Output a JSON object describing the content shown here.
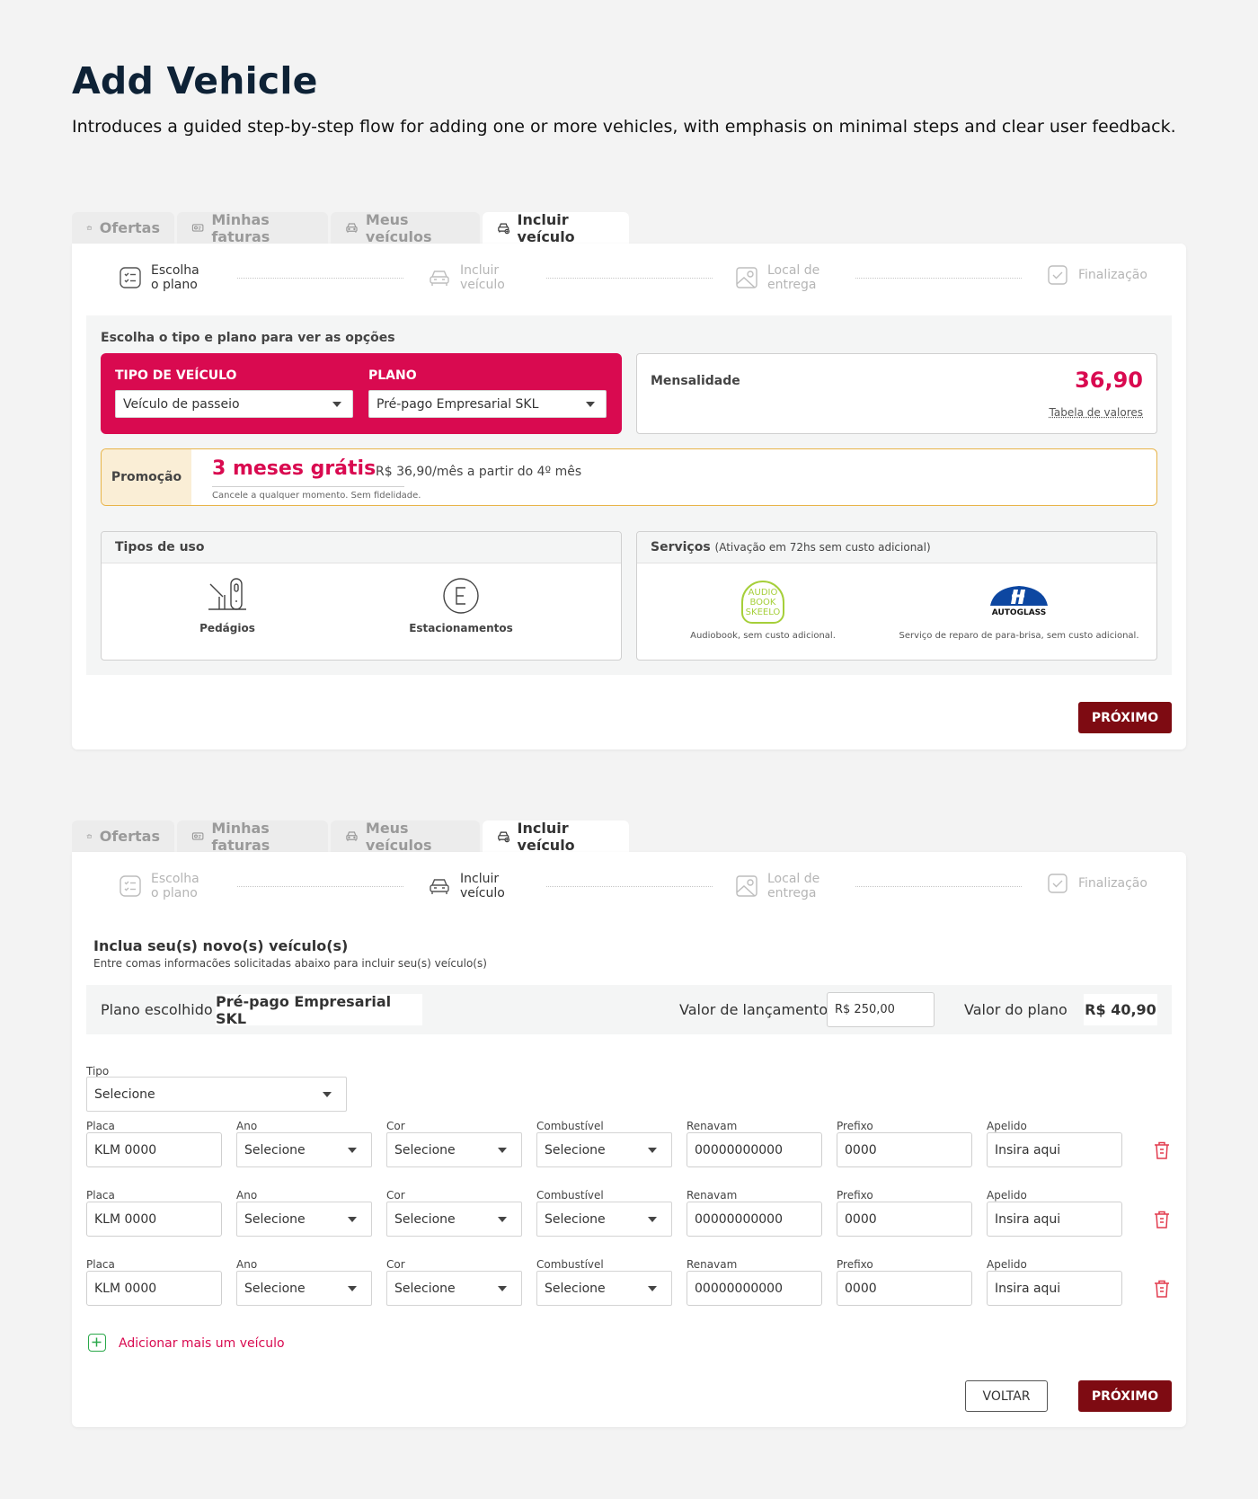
{
  "page": {
    "title": "Add Vehicle",
    "description": "Introduces a guided step-by-step flow for adding one or more vehicles, with emphasis on minimal steps and clear user feedback."
  },
  "tabs": [
    {
      "label": "Ofertas",
      "icon": "basket-icon"
    },
    {
      "label": "Minhas faturas",
      "icon": "invoice-icon"
    },
    {
      "label": "Meus veículos",
      "icon": "car-icon"
    },
    {
      "label": "Incluir veículo",
      "icon": "car-add-icon"
    }
  ],
  "steps": [
    {
      "line1": "Escolha",
      "line2": "o plano",
      "icon": "checklist-icon"
    },
    {
      "line1": "Incluir",
      "line2": "veículo",
      "icon": "car-icon"
    },
    {
      "line1": "Local de",
      "line2": "entrega",
      "icon": "map-icon"
    },
    {
      "line1": "Finalização",
      "line2": "",
      "icon": "check-icon"
    }
  ],
  "screen1": {
    "section_title": "Escolha o tipo e plano para ver as opções",
    "vehicle_type_label": "TIPO DE VEÍCULO",
    "vehicle_type_value": "Veículo de passeio",
    "plan_label": "PLANO",
    "plan_value": "Pré-pago Empresarial SKL",
    "monthly_label": "Mensalidade",
    "monthly_value": "36,90",
    "price_table_link": "Tabela de valores",
    "promo_tag": "Promoção",
    "promo_title": "3 meses grátis",
    "promo_price": "R$ 36,90/mês a partir do 4º mês",
    "promo_note": "Cancele a qualquer momento. Sem fidelidade.",
    "usage_title": "Tipos de uso",
    "usage_items": [
      "Pedágios",
      "Estacionamentos"
    ],
    "services_title": "Serviços",
    "services_note": "(Ativação em 72hs sem custo adicional)",
    "services": [
      {
        "logo_lines": [
          "AUDIO",
          "BOOK",
          "SKEELO"
        ],
        "desc": "Audiobook, sem custo adicional."
      },
      {
        "logo_text": "AUTOGLASS",
        "desc": "Serviço de reparo de para-brisa, sem custo adicional."
      }
    ],
    "next_button": "PRÓXIMO"
  },
  "screen2": {
    "section_title": "Inclua seu(s) novo(s) veículo(s)",
    "section_subtitle": "Entre comas informacões solicitadas abaixo para incluir seu(s) veículo(s)",
    "chosen_plan_label": "Plano escolhido",
    "chosen_plan_value": "Pré-pago Empresarial SKL",
    "launch_value_label": "Valor de lançamento",
    "launch_value": "R$ 250,00",
    "plan_value_label": "Valor do plano",
    "plan_value": "R$ 40,90",
    "tipo_label": "Tipo",
    "tipo_value": "Selecione",
    "columns": [
      "Placa",
      "Ano",
      "Cor",
      "Combustível",
      "Renavam",
      "Prefixo",
      "Apelido"
    ],
    "rows": [
      [
        "KLM 0000",
        "Selecione",
        "Selecione",
        "Selecione",
        "00000000000",
        "0000",
        "Insira aqui"
      ],
      [
        "KLM 0000",
        "Selecione",
        "Selecione",
        "Selecione",
        "00000000000",
        "0000",
        "Insira aqui"
      ],
      [
        "KLM 0000",
        "Selecione",
        "Selecione",
        "Selecione",
        "00000000000",
        "0000",
        "Insira aqui"
      ]
    ],
    "add_vehicle": "Adicionar mais um veículo",
    "back_button": "VOLTAR",
    "next_button": "PRÓXIMO"
  },
  "colors": {
    "brand_red": "#d90a50",
    "button_dark_red": "#7e0b12",
    "promo_border": "#e8b449",
    "add_green": "#2aa84a",
    "audiobook_green": "#a6cf3a",
    "autoglass_blue": "#0d47a1"
  }
}
